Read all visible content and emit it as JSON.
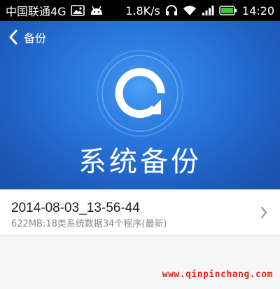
{
  "status_bar": {
    "carrier": "中国联通4G",
    "speed": "1.8K/s",
    "time": "14:20",
    "icons": [
      "image-icon",
      "android-icon",
      "headphones-icon",
      "wifi-icon",
      "signal-icon",
      "battery-icon"
    ]
  },
  "header": {
    "back_label": "备份"
  },
  "hero": {
    "title": "系统备份",
    "colors": {
      "accent": "#2a78dd",
      "accent_dark": "#1a4fa8"
    }
  },
  "backups": [
    {
      "name": "2014-08-03_13-56-44",
      "detail": "622MB:18类系统数据34个程序(最新)"
    }
  ],
  "watermark": "www.qinpinchang.com"
}
